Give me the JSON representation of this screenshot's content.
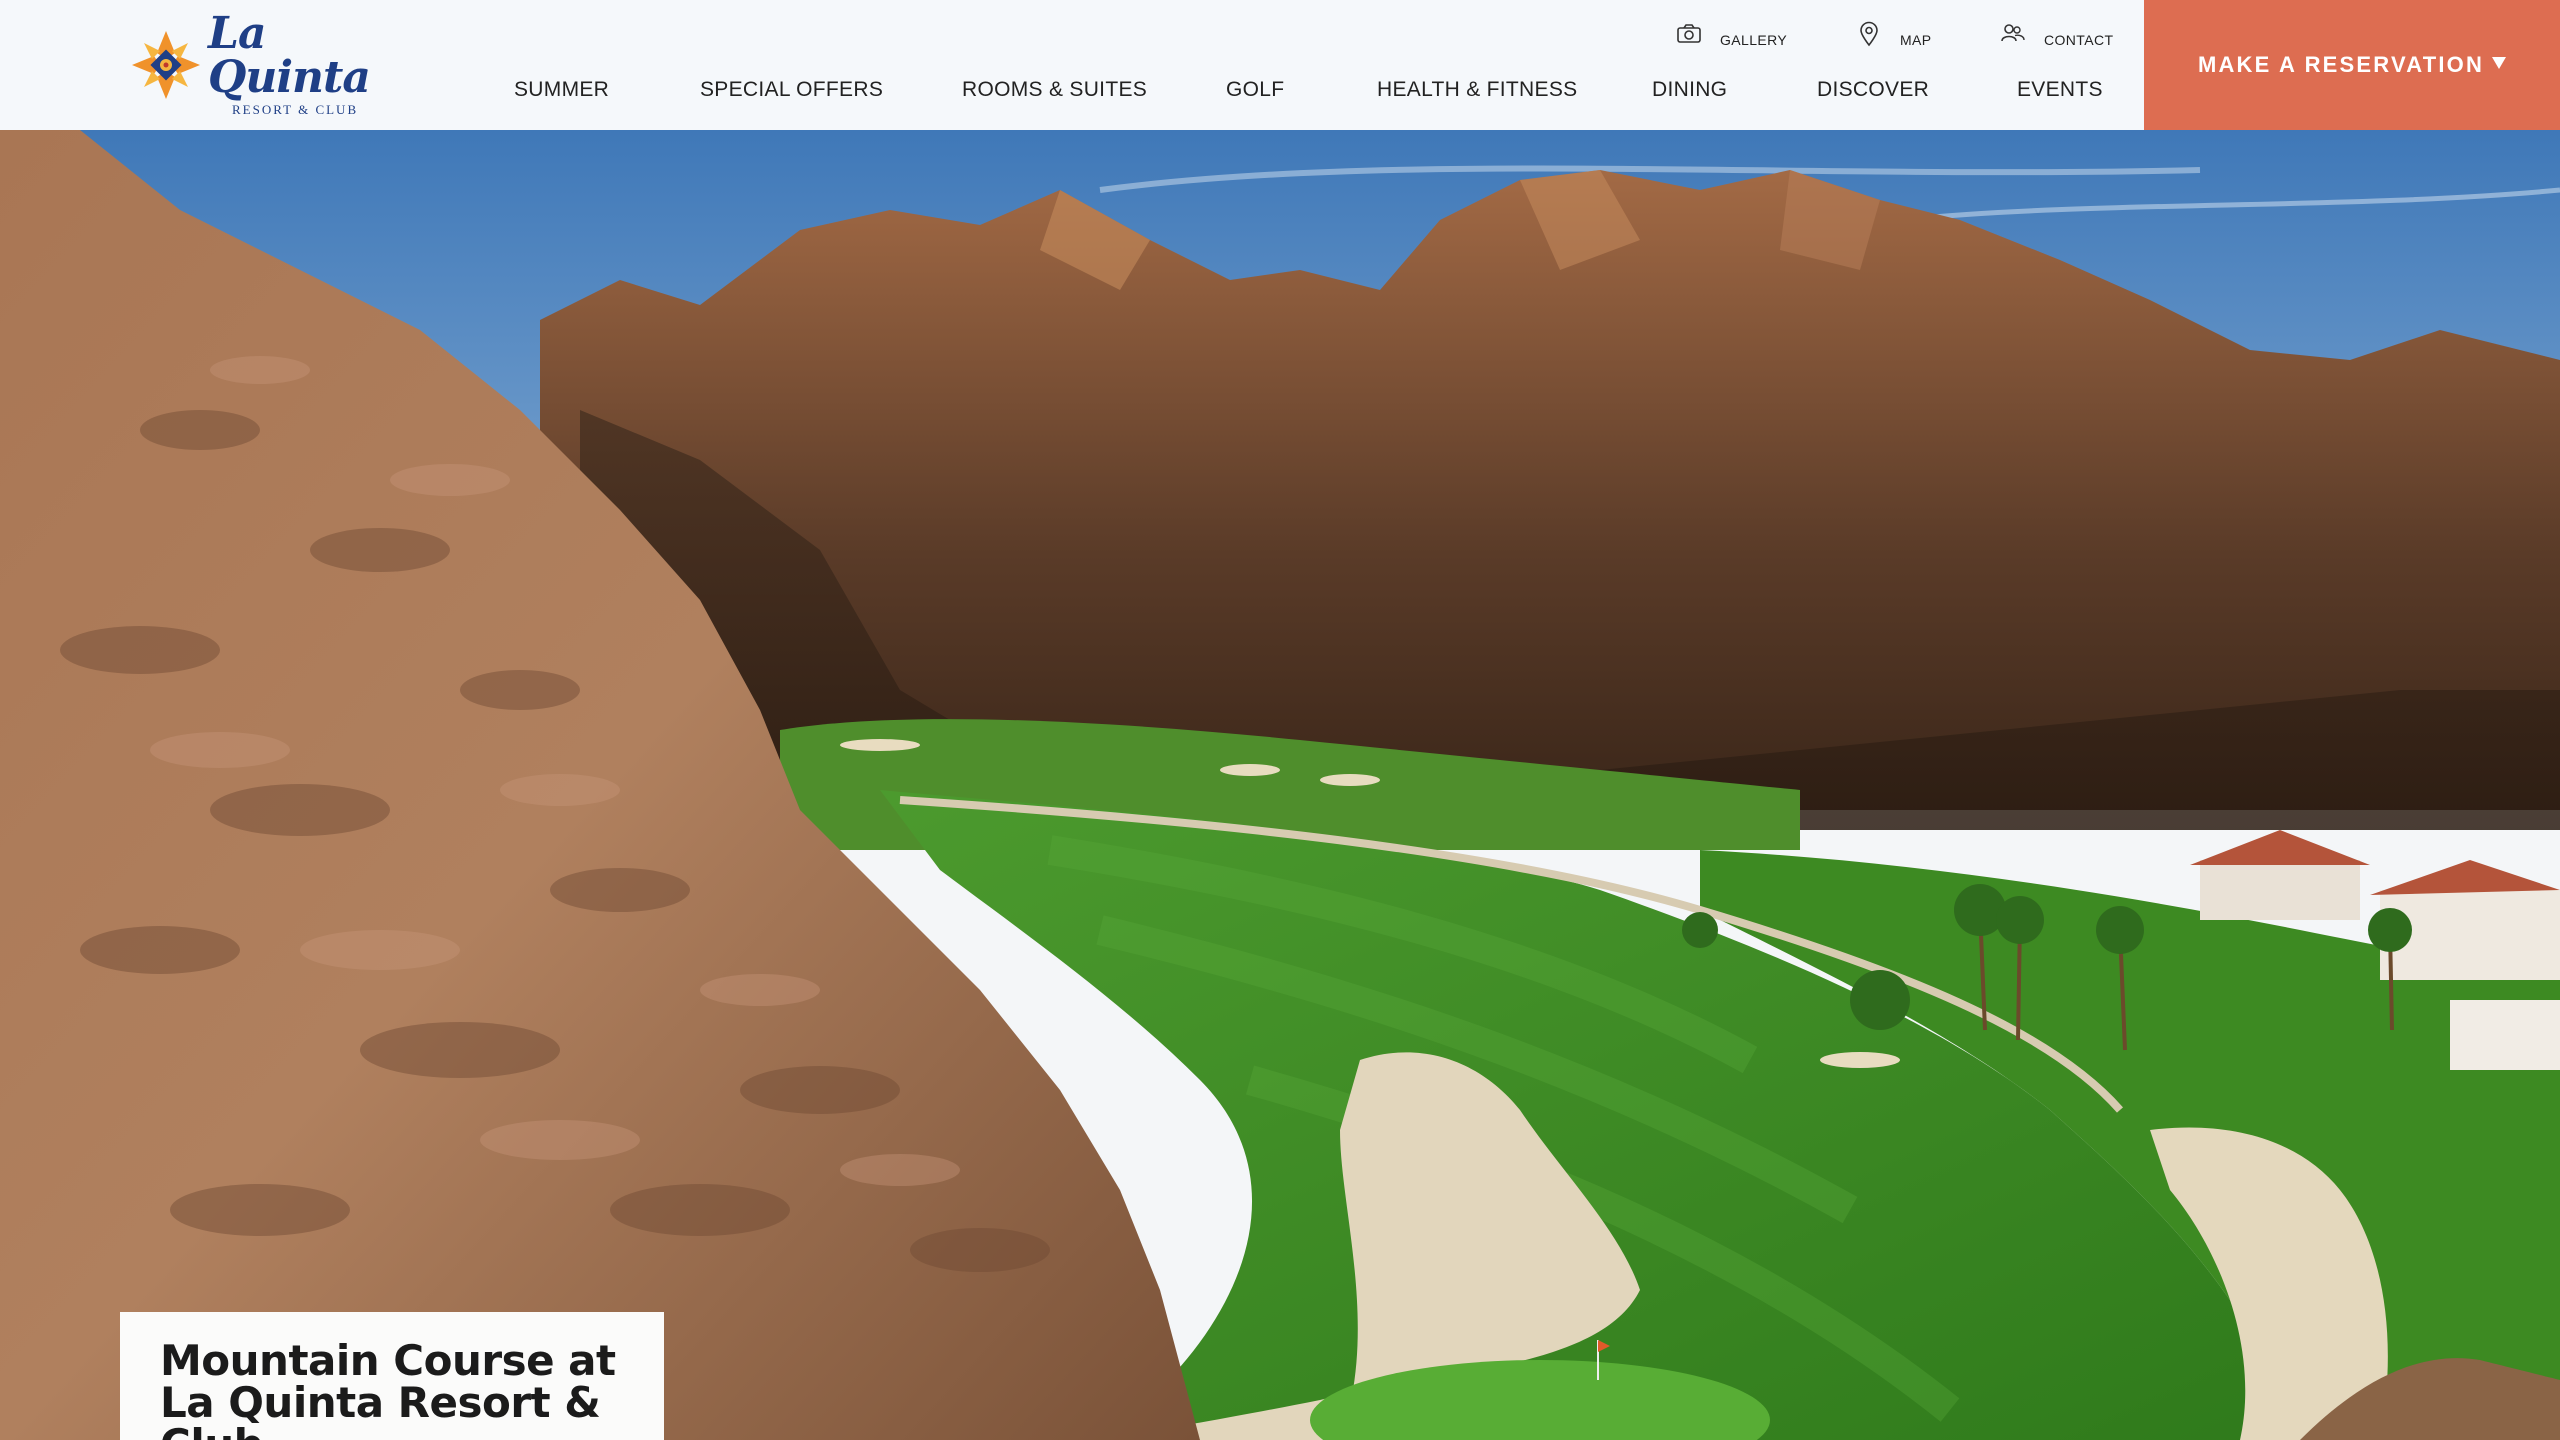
{
  "brand": {
    "name": "La Quinta",
    "subtitle": "RESORT & CLUB",
    "logo_icon": "sunburst-tile-icon",
    "colors": {
      "navy": "#1f3f86",
      "orange": "#f0922b",
      "accent": "#dd6d51"
    }
  },
  "utility_nav": [
    {
      "label": "GALLERY",
      "icon": "camera-icon"
    },
    {
      "label": "MAP",
      "icon": "map-pin-icon"
    },
    {
      "label": "CONTACT",
      "icon": "people-icon"
    }
  ],
  "main_nav": [
    {
      "label": "SUMMER"
    },
    {
      "label": "SPECIAL OFFERS"
    },
    {
      "label": "ROOMS & SUITES"
    },
    {
      "label": "GOLF"
    },
    {
      "label": "HEALTH & FITNESS"
    },
    {
      "label": "DINING"
    },
    {
      "label": "DISCOVER"
    },
    {
      "label": "EVENTS"
    }
  ],
  "reservation": {
    "label": "MAKE A RESERVATION",
    "icon": "caret-down-icon"
  },
  "hero": {
    "image": "aerial-golf-course-desert-mountains",
    "caption_title": "Mountain Course at La Quinta Resort & Club"
  }
}
